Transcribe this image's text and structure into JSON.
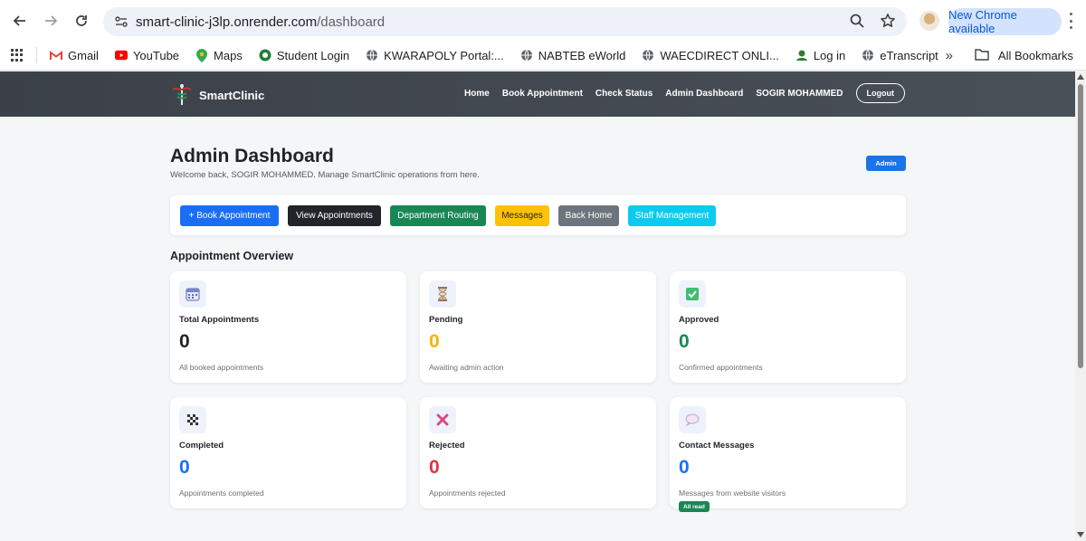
{
  "browser": {
    "url_host": "smart-clinic-j3lp.onrender.com",
    "url_path": "/dashboard",
    "new_chrome_label": "New Chrome available",
    "bookmarks": [
      {
        "label": "Gmail",
        "icon": "gmail-icon"
      },
      {
        "label": "YouTube",
        "icon": "youtube-icon"
      },
      {
        "label": "Maps",
        "icon": "maps-icon"
      },
      {
        "label": "Student Login",
        "icon": "student-login-icon"
      },
      {
        "label": "KWARAPOLY Portal:...",
        "icon": "globe-icon"
      },
      {
        "label": "NABTEB eWorld",
        "icon": "globe-icon"
      },
      {
        "label": "WAECDIRECT ONLI...",
        "icon": "globe-icon"
      },
      {
        "label": "Log in",
        "icon": "login-icon"
      },
      {
        "label": "eTranscript",
        "icon": "globe-icon"
      }
    ],
    "all_bookmarks_label": "All Bookmarks"
  },
  "site": {
    "brand": "SmartClinic",
    "nav": [
      "Home",
      "Book Appointment",
      "Check Status",
      "Admin Dashboard",
      "SOGIR MOHAMMED"
    ],
    "logout_label": "Logout"
  },
  "dashboard": {
    "title": "Admin Dashboard",
    "subtitle": "Welcome back, SOGIR MOHAMMED. Manage SmartClinic operations from here.",
    "role_badge": "Admin",
    "actions": [
      {
        "label": "+ Book Appointment",
        "bg": "#1a6ef5",
        "fg": "#ffffff"
      },
      {
        "label": "View Appointments",
        "bg": "#212529",
        "fg": "#ffffff"
      },
      {
        "label": "Department Routing",
        "bg": "#198754",
        "fg": "#ffffff"
      },
      {
        "label": "Messages",
        "bg": "#ffc107",
        "fg": "#1f2328"
      },
      {
        "label": "Back Home",
        "bg": "#6c757d",
        "fg": "#ffffff"
      },
      {
        "label": "Staff Management",
        "bg": "#0dcaf0",
        "fg": "#ffffff"
      }
    ],
    "overview_title": "Appointment Overview",
    "cards": [
      {
        "label": "Total Appointments",
        "value": "0",
        "desc": "All booked appointments",
        "color": "#1f2328",
        "icon": "calendar-icon"
      },
      {
        "label": "Pending",
        "value": "0",
        "desc": "Awaiting admin action",
        "color": "#f4b400",
        "icon": "hourglass-icon"
      },
      {
        "label": "Approved",
        "value": "0",
        "desc": "Confirmed appointments",
        "color": "#198754",
        "icon": "check-box-icon"
      },
      {
        "label": "Completed",
        "value": "0",
        "desc": "Appointments completed",
        "color": "#1a6ef5",
        "icon": "checkered-flag-icon"
      },
      {
        "label": "Rejected",
        "value": "0",
        "desc": "Appointments rejected",
        "color": "#dc3545",
        "icon": "cross-icon"
      },
      {
        "label": "Contact Messages",
        "value": "0",
        "desc": "Messages from website visitors",
        "color": "#1a6ef5",
        "icon": "speech-bubble-icon",
        "pill": "All read"
      }
    ]
  }
}
